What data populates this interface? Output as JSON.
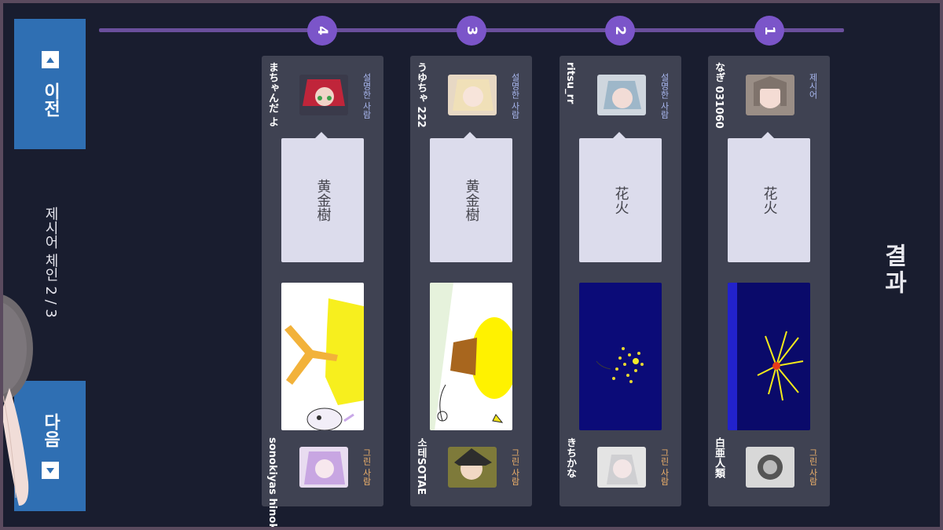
{
  "title": "결과",
  "steps": [
    "1",
    "2",
    "3",
    "4"
  ],
  "chain_label": "제시어 체인 2 / 3",
  "nav": {
    "prev_label": "이전",
    "next_label": "다음"
  },
  "cards": [
    {
      "role_top": "제시어",
      "top_name": "なぎ 031060",
      "word": "花火",
      "role_bottom": "그린 사람",
      "bottom_name": "白亜人類"
    },
    {
      "role_top": "설명한 사람",
      "top_name": "ritsu_rr",
      "word": "花火",
      "role_bottom": "그린 사람",
      "bottom_name": "きちかな"
    },
    {
      "role_top": "설명한 사람",
      "top_name": "うゆちゃ 222",
      "word": "黄金樹",
      "role_bottom": "그린 사람",
      "bottom_name": "소테SOTAE"
    },
    {
      "role_top": "설명한 사람",
      "top_name": "まちゃんだ よ",
      "word": "黄金樹",
      "role_bottom": "그린 사람",
      "bottom_name": "sonokiyas hinoki"
    }
  ],
  "colors": {
    "background": "#191d2f",
    "card": "#3f4252",
    "accent": "#7b55c9",
    "button": "#2f6fb3",
    "explainer_role": "#a9b8f0",
    "drawer_role": "#f0b26b"
  }
}
